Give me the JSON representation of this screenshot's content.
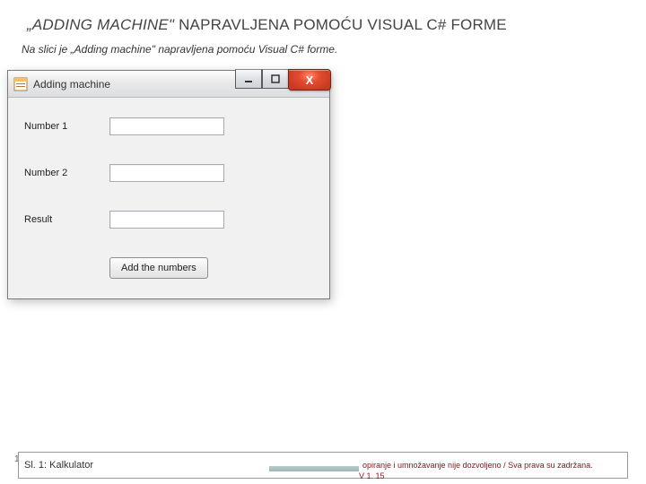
{
  "slide": {
    "title_italic": "„ADDING MACHINE\"",
    "title_rest": " NAPRAVLJENA POMOĆU VISUAL C# FORME",
    "caption": "Na slici je „Adding machine\" napravljena pomoću Visual C# forme."
  },
  "window": {
    "title": "Adding machine",
    "min_tooltip": "Minimize",
    "max_tooltip": "Maximize",
    "close_label": "X"
  },
  "form": {
    "labels": {
      "num1": "Number 1",
      "num2": "Number 2",
      "result": "Result"
    },
    "values": {
      "num1": "",
      "num2": "",
      "result": ""
    },
    "button": "Add the numbers"
  },
  "footer": {
    "page_number": "1",
    "figure_caption": "Sl. 1: Kalkulator",
    "copyright": "opiranje i umnožavanje nije dozvoljeno / Sva prava su zadržana.",
    "version": "V 1. 15"
  }
}
